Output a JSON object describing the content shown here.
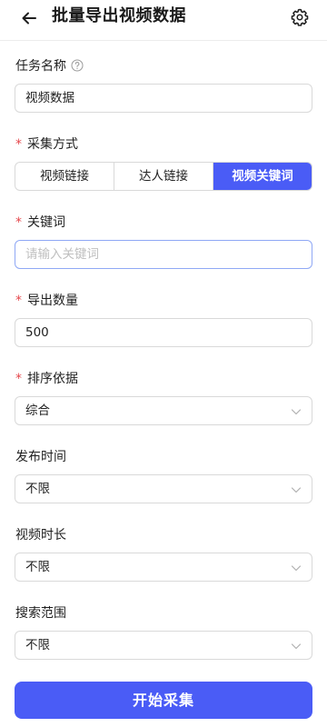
{
  "header": {
    "title": "批量导出视频数据",
    "back_icon": "arrow-left-icon",
    "settings_icon": "gear-icon"
  },
  "task_name": {
    "label": "任务名称",
    "help_icon": "question-circle-icon",
    "value": "视频数据"
  },
  "collect_method": {
    "required_mark": "*",
    "label": "采集方式",
    "options": [
      "视频链接",
      "达人链接",
      "视频关键词"
    ],
    "selected": "视频关键词"
  },
  "keyword": {
    "required_mark": "*",
    "label": "关键词",
    "placeholder": "请输入关键词",
    "value": ""
  },
  "export_count": {
    "required_mark": "*",
    "label": "导出数量",
    "value": "500"
  },
  "sort_by": {
    "required_mark": "*",
    "label": "排序依据",
    "value": "综合"
  },
  "publish_time": {
    "label": "发布时间",
    "value": "不限"
  },
  "video_duration": {
    "label": "视频时长",
    "value": "不限"
  },
  "search_scope": {
    "label": "搜索范围",
    "value": "不限"
  },
  "submit": {
    "label": "开始采集"
  },
  "colors": {
    "primary": "#4a5cf6",
    "required": "#e5484d",
    "border": "#d9d9d9",
    "focus_border": "#8fa8f5",
    "placeholder": "#bfbfbf"
  }
}
